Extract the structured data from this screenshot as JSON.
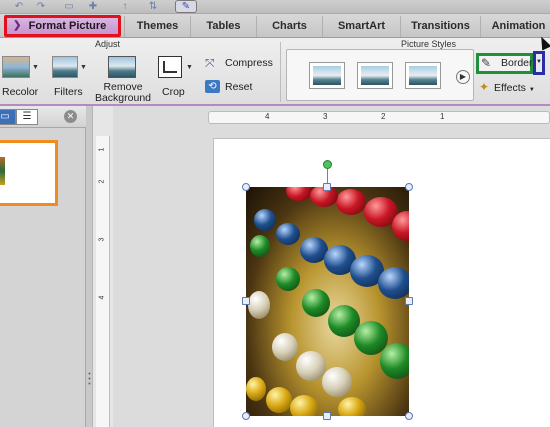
{
  "tabs": [
    {
      "label": "Format Picture",
      "active": true
    },
    {
      "label": "Themes"
    },
    {
      "label": "Tables"
    },
    {
      "label": "Charts"
    },
    {
      "label": "SmartArt"
    },
    {
      "label": "Transitions"
    },
    {
      "label": "Animation"
    }
  ],
  "ribbon": {
    "adjust_group": "Adjust",
    "picture_styles_group": "Picture Styles",
    "recolor": "Recolor",
    "filters": "Filters",
    "remove_background_1": "Remove",
    "remove_background_2": "Background",
    "crop": "Crop",
    "compress": "Compress",
    "reset": "Reset",
    "border": "Border",
    "effects": "Effects"
  },
  "ruler": {
    "h_ticks": [
      "4",
      "3",
      "2",
      "1"
    ],
    "v_ticks": [
      "1",
      "2",
      "3",
      "4"
    ]
  },
  "colors": {
    "format_tab": "#c993d2",
    "highlight_red": "#e1101d",
    "highlight_green": "#1f8f3c",
    "highlight_blue": "#2a2fa8",
    "slide_selection": "#f08c1e"
  },
  "icons": {
    "recolor": "recolor-icon",
    "filters": "filters-icon",
    "remove_background": "remove-background-icon",
    "crop": "crop-icon",
    "compress": "compress-icon",
    "reset": "reset-icon",
    "border": "pen-icon",
    "effects": "effects-icon"
  }
}
